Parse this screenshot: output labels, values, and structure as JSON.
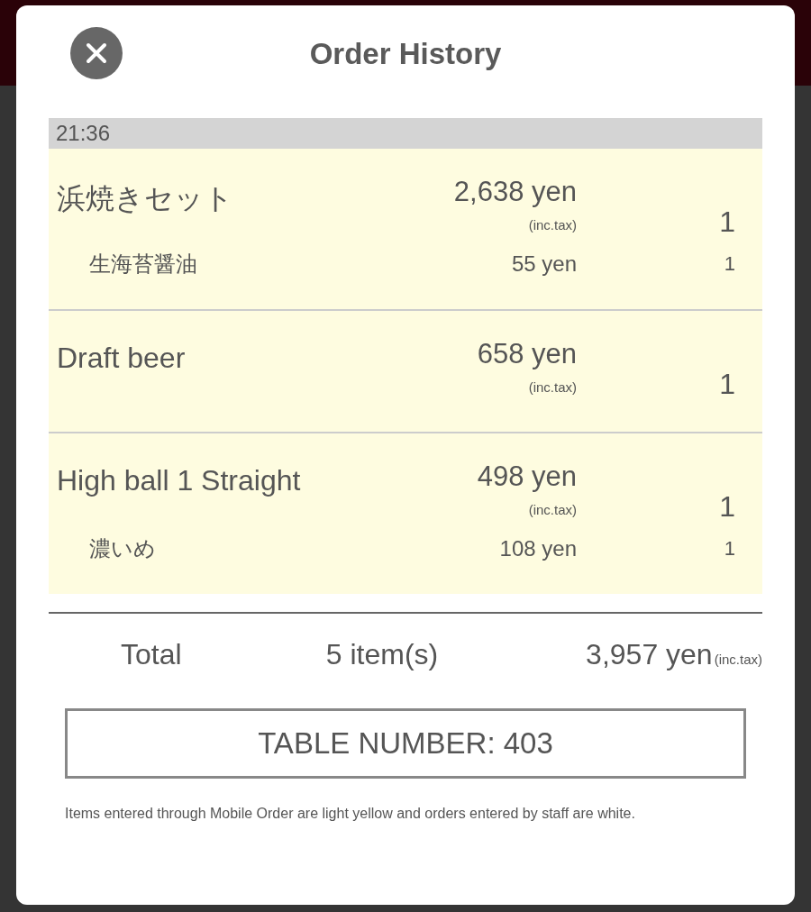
{
  "dialog": {
    "title": "Order History"
  },
  "time": "21:36",
  "orders": [
    {
      "name": "浜焼きセット",
      "price": "2,638 yen",
      "tax_note": "(inc.tax)",
      "qty": "1",
      "mobile_order": true,
      "options": [
        {
          "name": "生海苔醤油",
          "price": "55 yen",
          "qty": "1"
        }
      ]
    },
    {
      "name": "Draft beer",
      "price": "658 yen",
      "tax_note": "(inc.tax)",
      "qty": "1",
      "mobile_order": true
    },
    {
      "name": "High ball 1 Straight",
      "price": "498 yen",
      "tax_note": "(inc.tax)",
      "qty": "1",
      "mobile_order": true,
      "options": [
        {
          "name": "濃いめ",
          "price": "108 yen",
          "qty": "1"
        }
      ]
    }
  ],
  "total": {
    "label": "Total",
    "count": "5 item(s)",
    "amount": "3,957 yen",
    "tax_note": "(inc.tax)"
  },
  "table_number": "TABLE NUMBER: 403",
  "footnote": "Items entered through Mobile Order are light yellow and orders entered by staff are white."
}
